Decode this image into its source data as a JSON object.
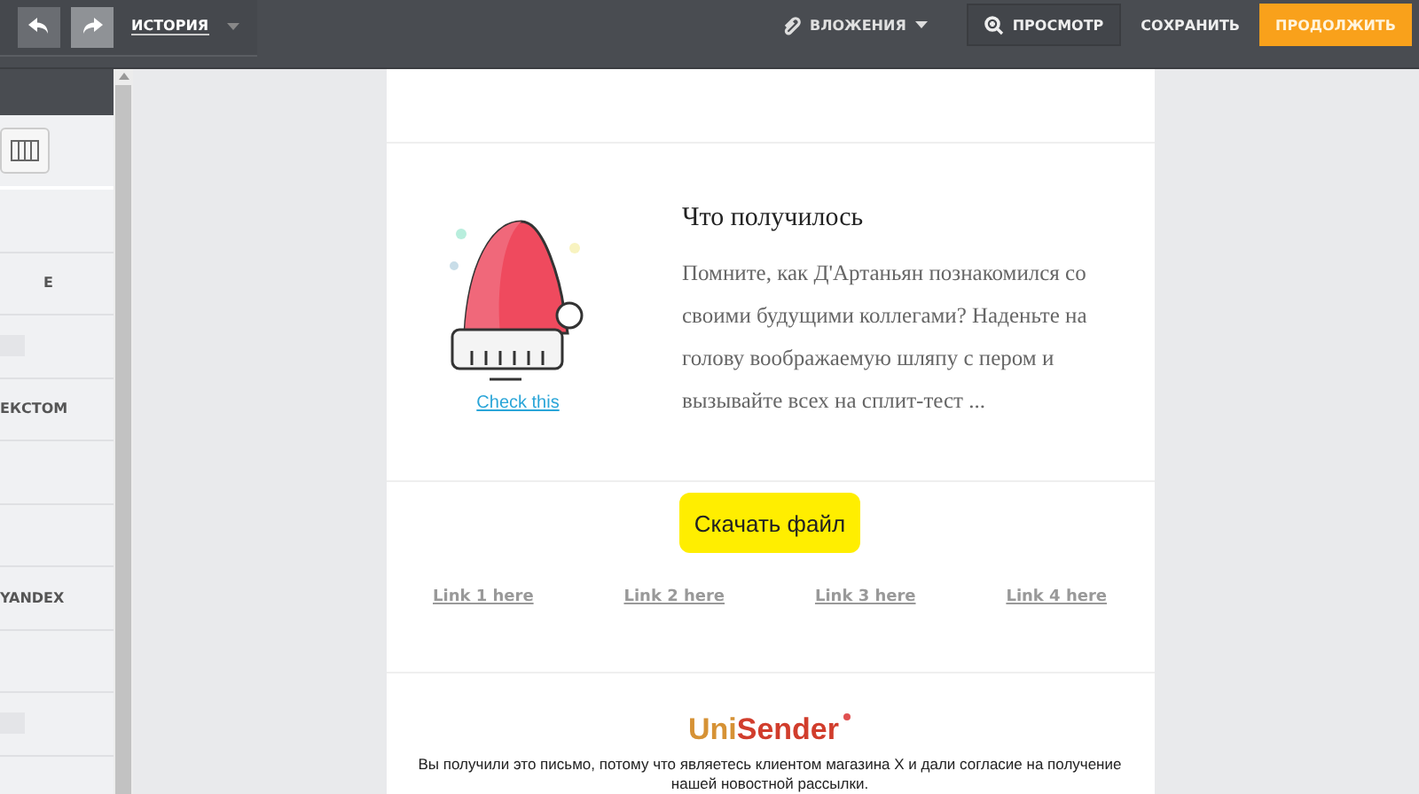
{
  "toolbar": {
    "history": "ИСТОРИЯ",
    "attachments": "ВЛОЖЕНИЯ",
    "buttons": [
      {
        "label": "ПРОСМОТР",
        "kind": "preview"
      },
      {
        "label": "СОХРАНИТЬ",
        "kind": "plain"
      },
      {
        "label": "ПРОДОЛЖИТЬ",
        "kind": "primary"
      }
    ]
  },
  "sidebar": {
    "rows": [
      {
        "kind": "empty"
      },
      {
        "kind": "text",
        "label": "Е"
      },
      {
        "kind": "faded"
      },
      {
        "kind": "text",
        "label": "ЕКСТОМ"
      },
      {
        "kind": "empty"
      },
      {
        "kind": "empty"
      },
      {
        "kind": "text",
        "label": "YANDEX"
      },
      {
        "kind": "empty"
      },
      {
        "kind": "faded"
      }
    ]
  },
  "email": {
    "card": {
      "link": "Check this",
      "title": "Что получилось",
      "text": "Помните, как Д'Артаньян познакомился со своими будущими коллегами? Наденьте на голову воображаемую шляпу с пером и вызывайте всех на сплит-тест ..."
    },
    "button": "Скачать файл",
    "links": [
      "Link 1 here",
      "Link 2 here",
      "Link 3 here",
      "Link 4 here"
    ],
    "logo": {
      "part_1": "Uni",
      "part_2": "Sender"
    },
    "footer": "Вы получили это письмо, потому что являетесь клиентом магазина X и дали согласие на получение нашей новостной рассылки."
  }
}
